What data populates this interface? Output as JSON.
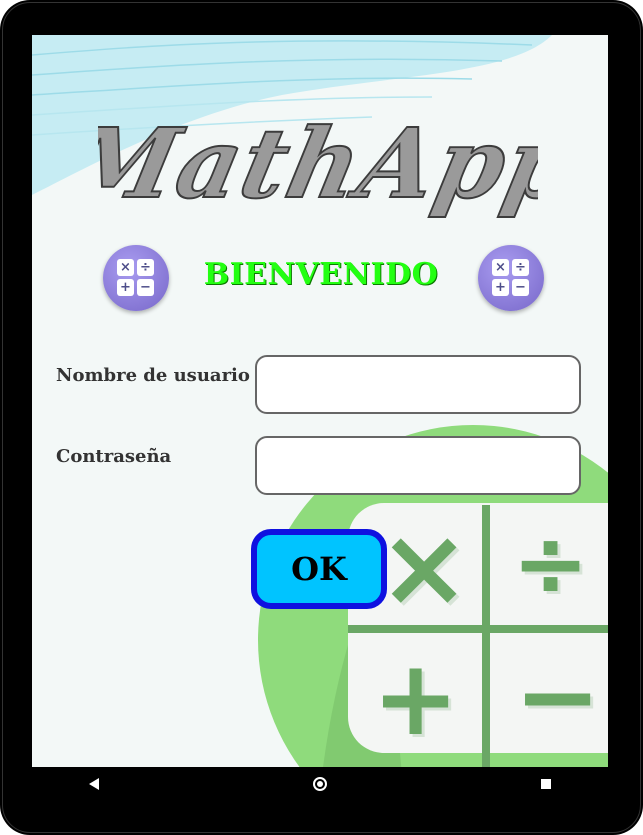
{
  "app": {
    "logo_text": "MathApp",
    "welcome_text": "BIENVENIDO"
  },
  "form": {
    "username_label": "Nombre de usuario",
    "username_value": "",
    "password_label": "Contraseña",
    "password_value": "",
    "ok_label": "OK"
  },
  "calc_icon_symbols": [
    "×",
    "÷",
    "+",
    "−"
  ],
  "background_symbols": [
    "×",
    "÷",
    "+",
    "−"
  ],
  "nav": {
    "back_icon": "back-triangle-icon",
    "home_icon": "home-circle-icon",
    "recents_icon": "recents-square-icon"
  },
  "colors": {
    "welcome": "#23ff12",
    "ok_fill": "#00c4ff",
    "ok_border": "#0f11e0",
    "calc_icon": "#7767c9",
    "decor_green": "#8fdb7c"
  }
}
